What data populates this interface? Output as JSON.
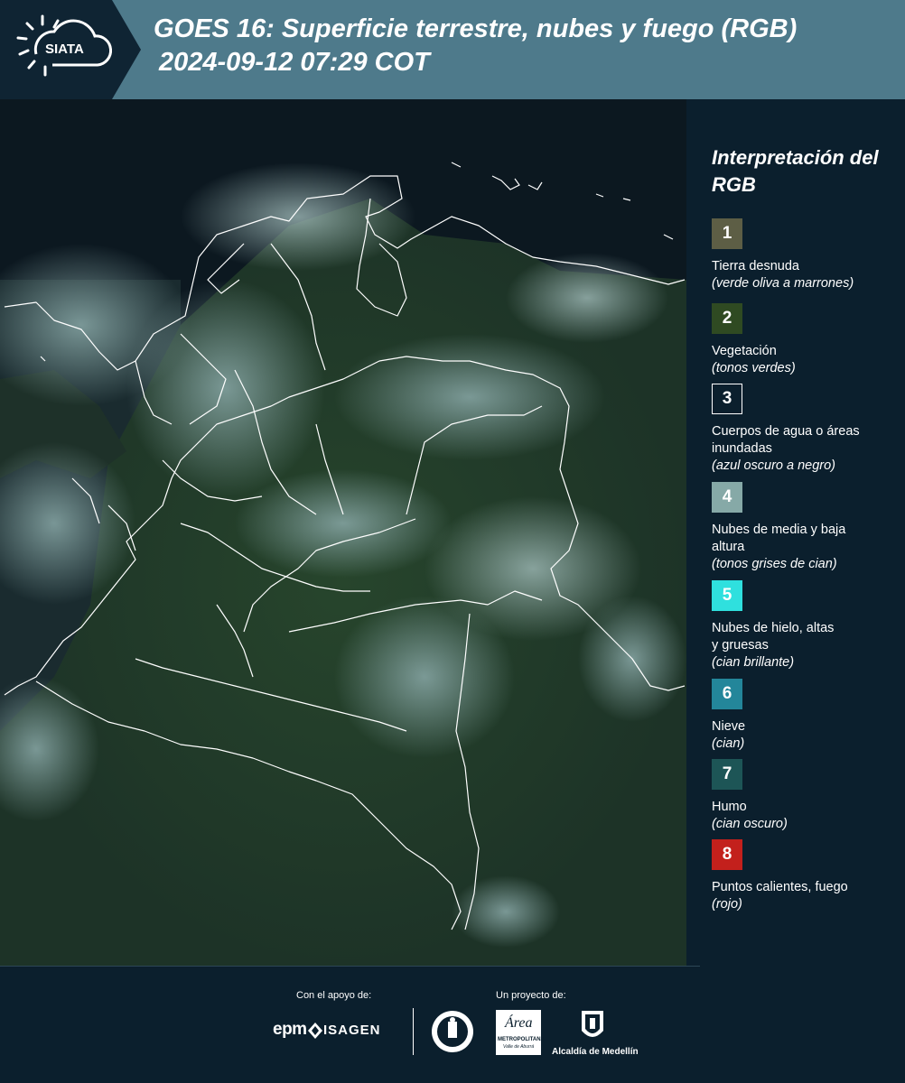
{
  "header": {
    "logo_text": "SIATA",
    "title_line1": "GOES 16: Superficie terrestre, nubes y fuego (RGB)",
    "title_line2": "2024-09-12 07:29 COT"
  },
  "legend": {
    "title": "Interpretación del RGB",
    "items": [
      {
        "number": "1",
        "name": "Tierra desnuda",
        "sub": "(verde oliva a marrones)",
        "color": "#5d5e45"
      },
      {
        "number": "2",
        "name": "Vegetación",
        "sub": "(tonos verdes)",
        "color": "#2f4a22"
      },
      {
        "number": "3",
        "name": "Cuerpos de agua o áreas inundadas",
        "sub": "(azul oscuro a negro)",
        "color": "#0b1f2d"
      },
      {
        "number": "4",
        "name": "Nubes de media y baja altura",
        "sub": "(tonos grises de cian)",
        "color": "#86a9a7"
      },
      {
        "number": "5",
        "name": "Nubes de hielo, altas y gruesas",
        "sub": "(cian brillante)",
        "color": "#2fe0de"
      },
      {
        "number": "6",
        "name": "Nieve",
        "sub": "(cian)",
        "color": "#23869a"
      },
      {
        "number": "7",
        "name": "Humo",
        "sub": "(cian oscuro)",
        "color": "#1d5556"
      },
      {
        "number": "8",
        "name": "Puntos calientes, fuego",
        "sub": "(rojo)",
        "color": "#c3201c"
      }
    ]
  },
  "footer": {
    "support_label": "Con el apoyo de:",
    "project_label": "Un proyecto de:",
    "epm": "epm",
    "isagen": "ISAGEN",
    "metropolitana": "METROPOLITANA",
    "area": "Área",
    "valle": "Valle de Aburrá",
    "alcaldia": "Alcaldía de Medellín"
  }
}
